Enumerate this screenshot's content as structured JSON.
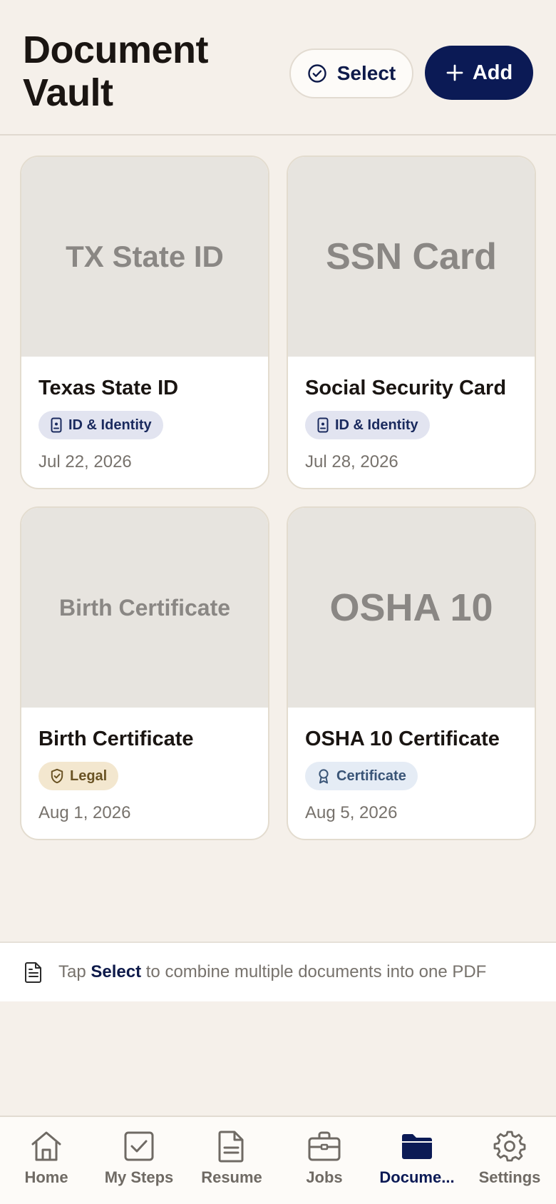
{
  "header": {
    "title": "Document Vault",
    "select_label": "Select",
    "add_label": "Add"
  },
  "documents": [
    {
      "thumb_text": "TX State ID",
      "title": "Texas State ID",
      "badge": "ID & Identity",
      "badge_icon": "phone-id-icon",
      "date": "Jul 22, 2026"
    },
    {
      "thumb_text": "SSN Card",
      "title": "Social Security Card",
      "badge": "ID & Identity",
      "badge_icon": "phone-id-icon",
      "date": "Jul 28, 2026"
    },
    {
      "thumb_text": "Birth Certificate",
      "title": "Birth Certificate",
      "badge": "Legal",
      "badge_icon": "shield-icon",
      "date": "Aug 1, 2026"
    },
    {
      "thumb_text": "OSHA 10",
      "title": "OSHA 10 Certificate",
      "badge": "Certificate",
      "badge_icon": "award-icon",
      "date": "Aug 5, 2026"
    }
  ],
  "hint": {
    "prefix": "Tap",
    "emphasis": "Select",
    "suffix": "to combine multiple documents into one PDF"
  },
  "nav": [
    {
      "label": "Home",
      "icon": "home-icon"
    },
    {
      "label": "My Steps",
      "icon": "checkbox-icon"
    },
    {
      "label": "Resume",
      "icon": "file-icon"
    },
    {
      "label": "Jobs",
      "icon": "briefcase-icon"
    },
    {
      "label": "Docume...",
      "icon": "folder-icon",
      "active": true
    },
    {
      "label": "Settings",
      "icon": "gear-icon"
    }
  ],
  "colors": {
    "primary": "#0b1a55",
    "background": "#f5f0ea"
  }
}
